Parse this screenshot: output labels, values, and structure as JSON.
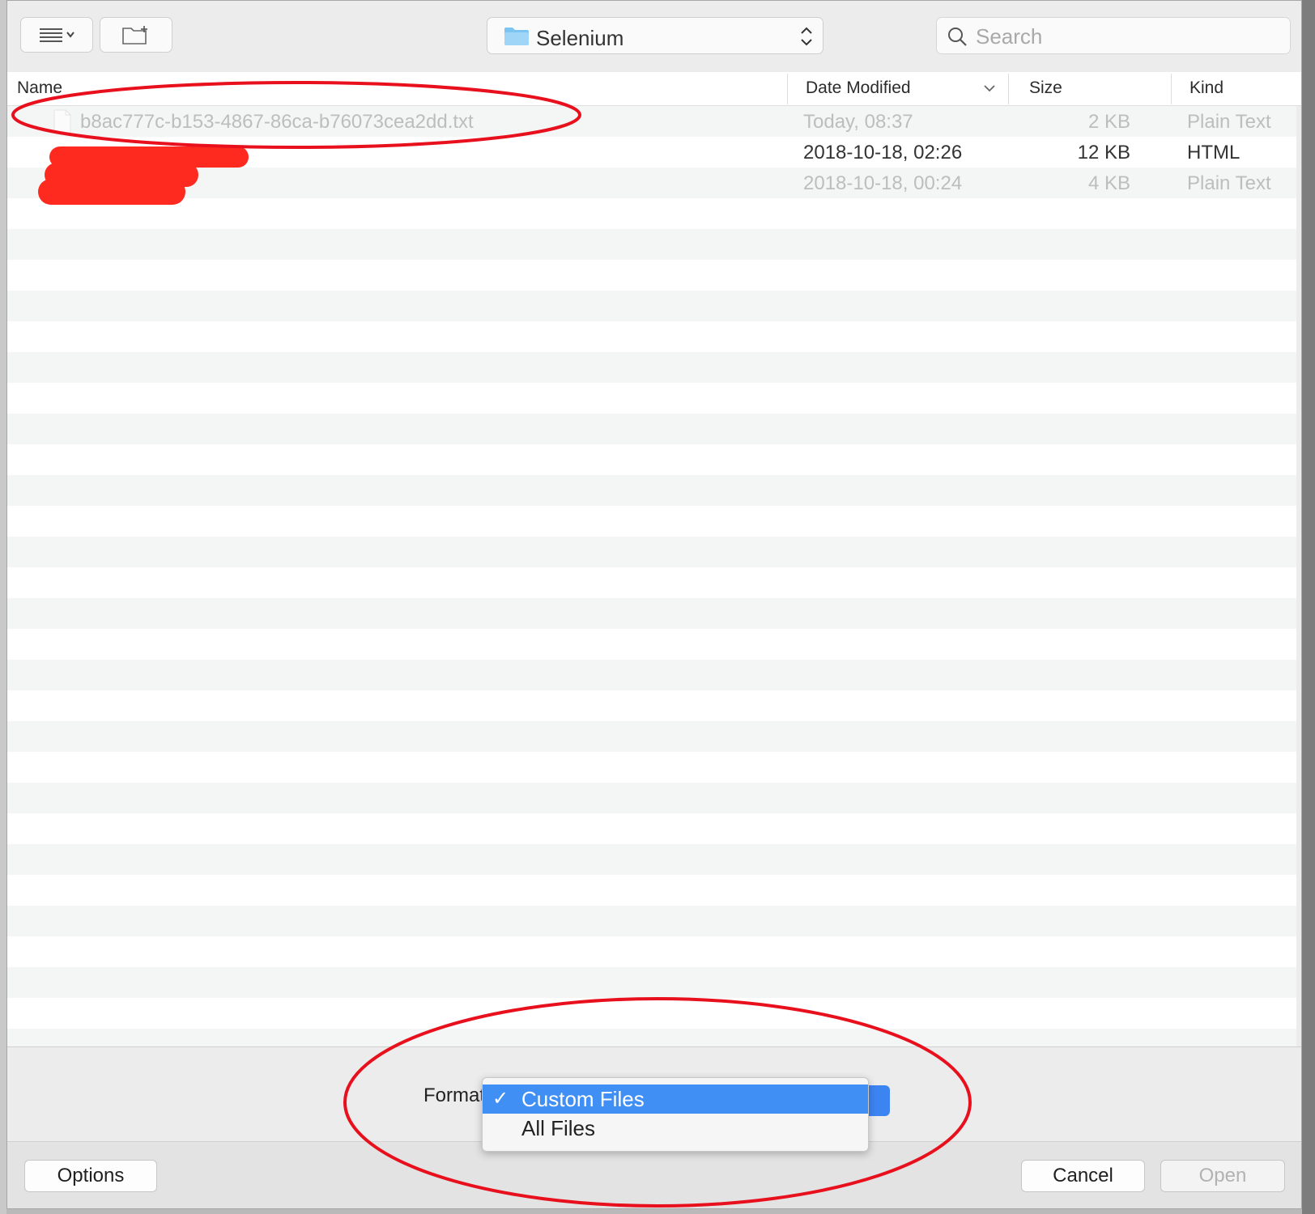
{
  "toolbar": {
    "view_button_icon": "list-view-icon",
    "new_folder_icon": "new-folder-icon",
    "location_title": "Selenium",
    "search_placeholder": "Search"
  },
  "columns": {
    "name": "Name",
    "date_modified": "Date Modified",
    "size": "Size",
    "kind": "Kind"
  },
  "files": [
    {
      "name": "b8ac777c-b153-4867-86ca-b76073cea2dd.txt",
      "date": "Today, 08:37",
      "size": "2 KB",
      "kind": "Plain Text"
    },
    {
      "name": "",
      "date": "2018-10-18, 02:26",
      "size": "12 KB",
      "kind": "HTML"
    },
    {
      "name": "",
      "date": "2018-10-18, 00:24",
      "size": "4 KB",
      "kind": "Plain Text"
    }
  ],
  "format": {
    "label": "Format",
    "options": [
      {
        "label": "Custom Files",
        "selected": true
      },
      {
        "label": "All Files",
        "selected": false
      }
    ]
  },
  "buttons": {
    "options": "Options",
    "cancel": "Cancel",
    "open": "Open"
  },
  "colors": {
    "annotation": "#e8101c",
    "redaction": "#ff2a1f",
    "selection": "#3f8ff5"
  }
}
